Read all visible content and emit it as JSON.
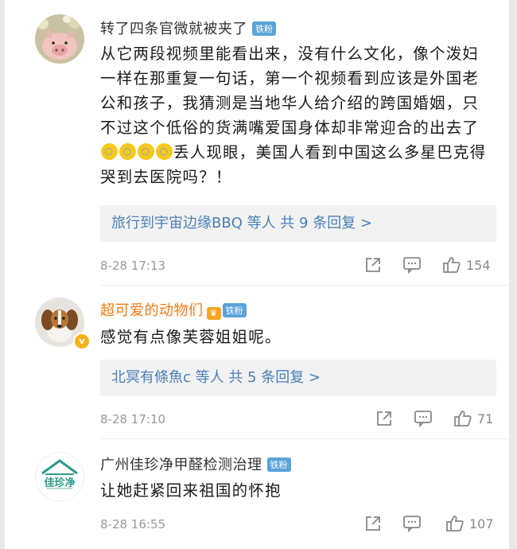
{
  "comments": [
    {
      "username": "转了四条官微就被夹了",
      "badge": "铁粉",
      "text_part1": "从它两段视频里能看出来，没有什么文化，像个泼妇一样在那重复一句话，第一个视频看到应该是外国老公和孩子，我猜测是当地华人给介绍的跨国婚姻，只不过这个低俗的货满嘴爱国身体却非常迎合的出去了",
      "text_part2": "丢人现眼，美国人看到中国这么多星巴克得哭到去医院吗？！",
      "emoji_icon": "laughing-crying-emoji",
      "replies_summary": "旅行到宇宙边缘BBQ 等人  共 9 条回复 >",
      "timestamp": "8-28 17:13",
      "like_count": "154"
    },
    {
      "username": "超可爱的动物们",
      "badge": "铁粉",
      "verified_icon": "v",
      "text": "感觉有点像芙蓉姐姐呢。",
      "replies_summary": "北冥有條魚c 等人  共 5 条回复 >",
      "timestamp": "8-28 17:10",
      "like_count": "71"
    },
    {
      "username": "广州佳珍净甲醛检测治理",
      "badge": "铁粉",
      "avatar_logo_text": "佳珍净",
      "text": "让她赶紧回来祖国的怀抱",
      "timestamp": "8-28 16:55",
      "like_count": "107"
    }
  ],
  "colors": {
    "name_default": "#333333",
    "name_highlight": "#f17b15",
    "reply_link": "#4a7fb6",
    "badge_bg": "#5ba3d9",
    "meta": "#999999"
  }
}
